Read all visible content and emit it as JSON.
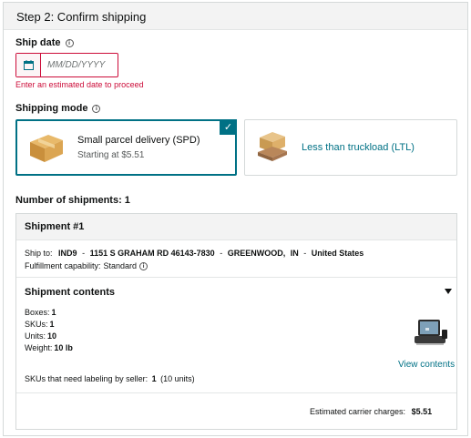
{
  "header": {
    "title": "Step 2: Confirm shipping"
  },
  "ship_date": {
    "label": "Ship date",
    "placeholder": "MM/DD/YYYY",
    "value": "",
    "error": "Enter an estimated date to proceed"
  },
  "shipping_mode": {
    "label": "Shipping mode",
    "options": [
      {
        "title": "Small parcel delivery (SPD)",
        "subtitle": "Starting at $5.51",
        "selected": true
      },
      {
        "title": "Less than truckload (LTL)",
        "selected": false
      }
    ]
  },
  "shipments": {
    "count_label": "Number of shipments:",
    "count": "1",
    "shipment": {
      "title": "Shipment #1",
      "ship_to_label": "Ship to:",
      "ship_to": {
        "code": "IND9",
        "street": "1151 S GRAHAM RD 46143-7830",
        "city": "GREENWOOD,",
        "state": "IN",
        "country": "United States",
        "sep": "-"
      },
      "fulfillment_label": "Fulfillment capability:",
      "fulfillment_value": "Standard",
      "contents_title": "Shipment contents",
      "boxes_label": "Boxes:",
      "boxes": "1",
      "skus_label": "SKUs:",
      "skus": "1",
      "units_label": "Units:",
      "units": "10",
      "weight_label": "Weight:",
      "weight": "10 lb",
      "labeling_label": "SKUs that need labeling by seller:",
      "labeling_count": "1",
      "labeling_units": "(10 units)",
      "view_contents": "View contents",
      "charges_label": "Estimated carrier charges:",
      "charges_value": "$5.51"
    }
  },
  "colors": {
    "accent": "#007185",
    "error": "#cc0c39",
    "header_bg": "#f3f3f3"
  },
  "icons": [
    "info-icon",
    "calendar-icon",
    "checkmark-icon",
    "parcel-box-icon",
    "pallet-icon",
    "caret-down-icon",
    "product-thumbnail-icon"
  ]
}
